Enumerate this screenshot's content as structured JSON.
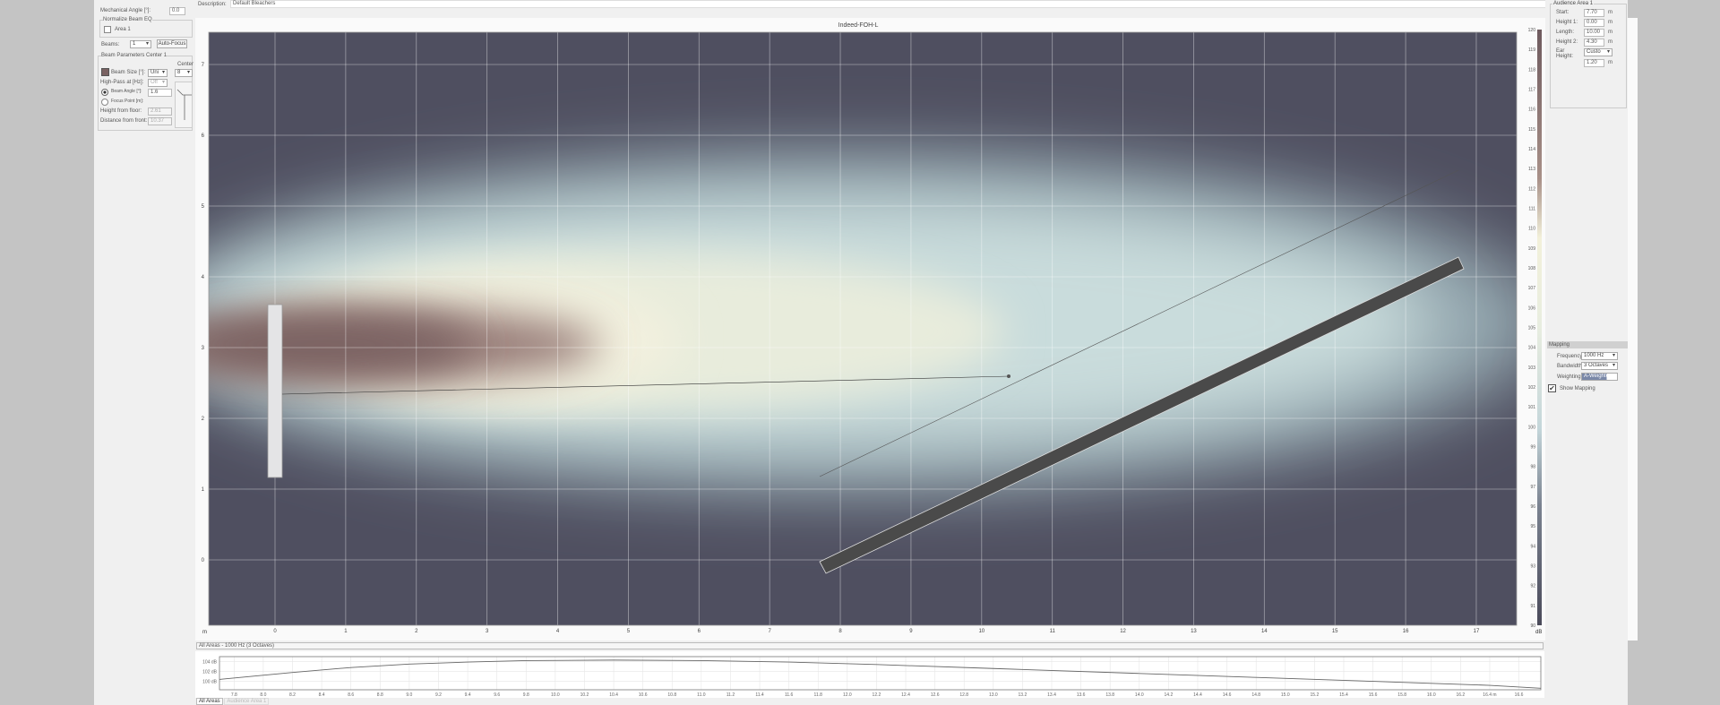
{
  "left_panel": {
    "mechanical_angle_label": "Mechanical Angle [°]:",
    "mechanical_angle": "0.0",
    "normalize_group": "Normalize Beam EQ",
    "area1_label": "Area 1",
    "beams_label": "Beams:",
    "beams_value": "1",
    "auto_focus": "Auto-Focus",
    "beam_params_group": "Beam Parameters Center 1",
    "center_label": "Center",
    "beam_size_label": "Beam Size [°]:",
    "beam_size_value": "Uni",
    "center_value": "8",
    "high_pass_label": "High-Pass at [Hz]:",
    "high_pass_value": "Off",
    "beam_angle_label": "Beam Angle [°]:",
    "beam_angle_value": "1.6",
    "focus_point_label": "Focus Point [m]:",
    "height_floor_label": "Height from floor:",
    "height_floor_value": "2.61",
    "distance_front_label": "Distance from front:",
    "distance_front_value": "10.37",
    "beam_color": "#7a6262"
  },
  "description": {
    "label": "Description:",
    "value": "Default Bleachers"
  },
  "right_panel": {
    "group": "Audience Area 1",
    "fields": [
      {
        "label": "Start:",
        "value": "7.70",
        "unit": "m"
      },
      {
        "label": "Height 1:",
        "value": "0.00",
        "unit": "m"
      },
      {
        "label": "Length:",
        "value": "10.00",
        "unit": "m"
      },
      {
        "label": "Height 2:",
        "value": "4.30",
        "unit": "m"
      }
    ],
    "ear_height_label": "Ear Height:",
    "ear_height_mode": "Custo",
    "ear_height_value": "1.20",
    "ear_unit": "m",
    "mapping_header": "Mapping",
    "frequency_label": "Frequency:",
    "frequency_value": "1000 Hz",
    "bandwidth_label": "Bandwidth:",
    "bandwidth_value": "3 Octaves",
    "weighting_label": "Weighting:",
    "weighting_value": "A-Weighted",
    "show_mapping": "Show Mapping",
    "show_mapping_checked": true
  },
  "plot": {
    "title": "Indeed-FOH-L",
    "x_unit": "m",
    "colorbar_unit": "dB",
    "x_ticks": [
      "0",
      "1",
      "2",
      "3",
      "4",
      "5",
      "6",
      "7",
      "8",
      "9",
      "10",
      "11",
      "12",
      "13",
      "14",
      "15",
      "16",
      "17"
    ],
    "y_ticks": [
      "0",
      "1",
      "2",
      "3",
      "4",
      "5",
      "6",
      "7"
    ],
    "colorbar_ticks": [
      "90",
      "91",
      "92",
      "93",
      "94",
      "95",
      "96",
      "97",
      "98",
      "99",
      "100",
      "101",
      "102",
      "103",
      "104",
      "105",
      "106",
      "107",
      "108",
      "109",
      "110",
      "111",
      "112",
      "113",
      "114",
      "115",
      "116",
      "117",
      "118",
      "119",
      "120"
    ]
  },
  "bottom": {
    "header": "All Areas - 1000 Hz (3 Octaves)",
    "tabs": [
      "All Areas",
      "Audience Area 1"
    ]
  },
  "chart_data": {
    "type": "line",
    "title": "All Areas - 1000 Hz (3 Octaves)",
    "xlabel": "m",
    "ylabel": "dB",
    "xlim": [
      7.7,
      16.75
    ],
    "ylim": [
      98.3,
      105
    ],
    "y_ticks": [
      "104 dB",
      "102 dB",
      "100 dB"
    ],
    "x_ticks": [
      "7.8",
      "8.0",
      "8.2",
      "8.4",
      "8.6",
      "8.8",
      "9.0",
      "9.2",
      "9.4",
      "9.6",
      "9.8",
      "10.0",
      "10.2",
      "10.4",
      "10.6",
      "10.8",
      "11.0",
      "11.2",
      "11.4",
      "11.6",
      "11.8",
      "12.0",
      "12.2",
      "12.4",
      "12.6",
      "12.8",
      "13.0",
      "13.2",
      "13.4",
      "13.6",
      "13.8",
      "14.0",
      "14.2",
      "14.4",
      "14.6",
      "14.8",
      "15.0",
      "15.2",
      "15.4",
      "15.6",
      "15.8",
      "16.0",
      "16.2",
      "16.4 m",
      "16.6"
    ],
    "x": [
      7.7,
      8.2,
      8.6,
      9.0,
      9.4,
      9.8,
      10.4,
      11.0,
      11.6,
      12.2,
      13.0,
      14.0,
      14.8,
      15.6,
      16.4,
      16.75
    ],
    "y": [
      100.4,
      101.8,
      102.8,
      103.5,
      103.9,
      104.2,
      104.3,
      104.2,
      103.9,
      103.4,
      102.6,
      101.6,
      100.8,
      100.0,
      99.2,
      98.6
    ]
  }
}
